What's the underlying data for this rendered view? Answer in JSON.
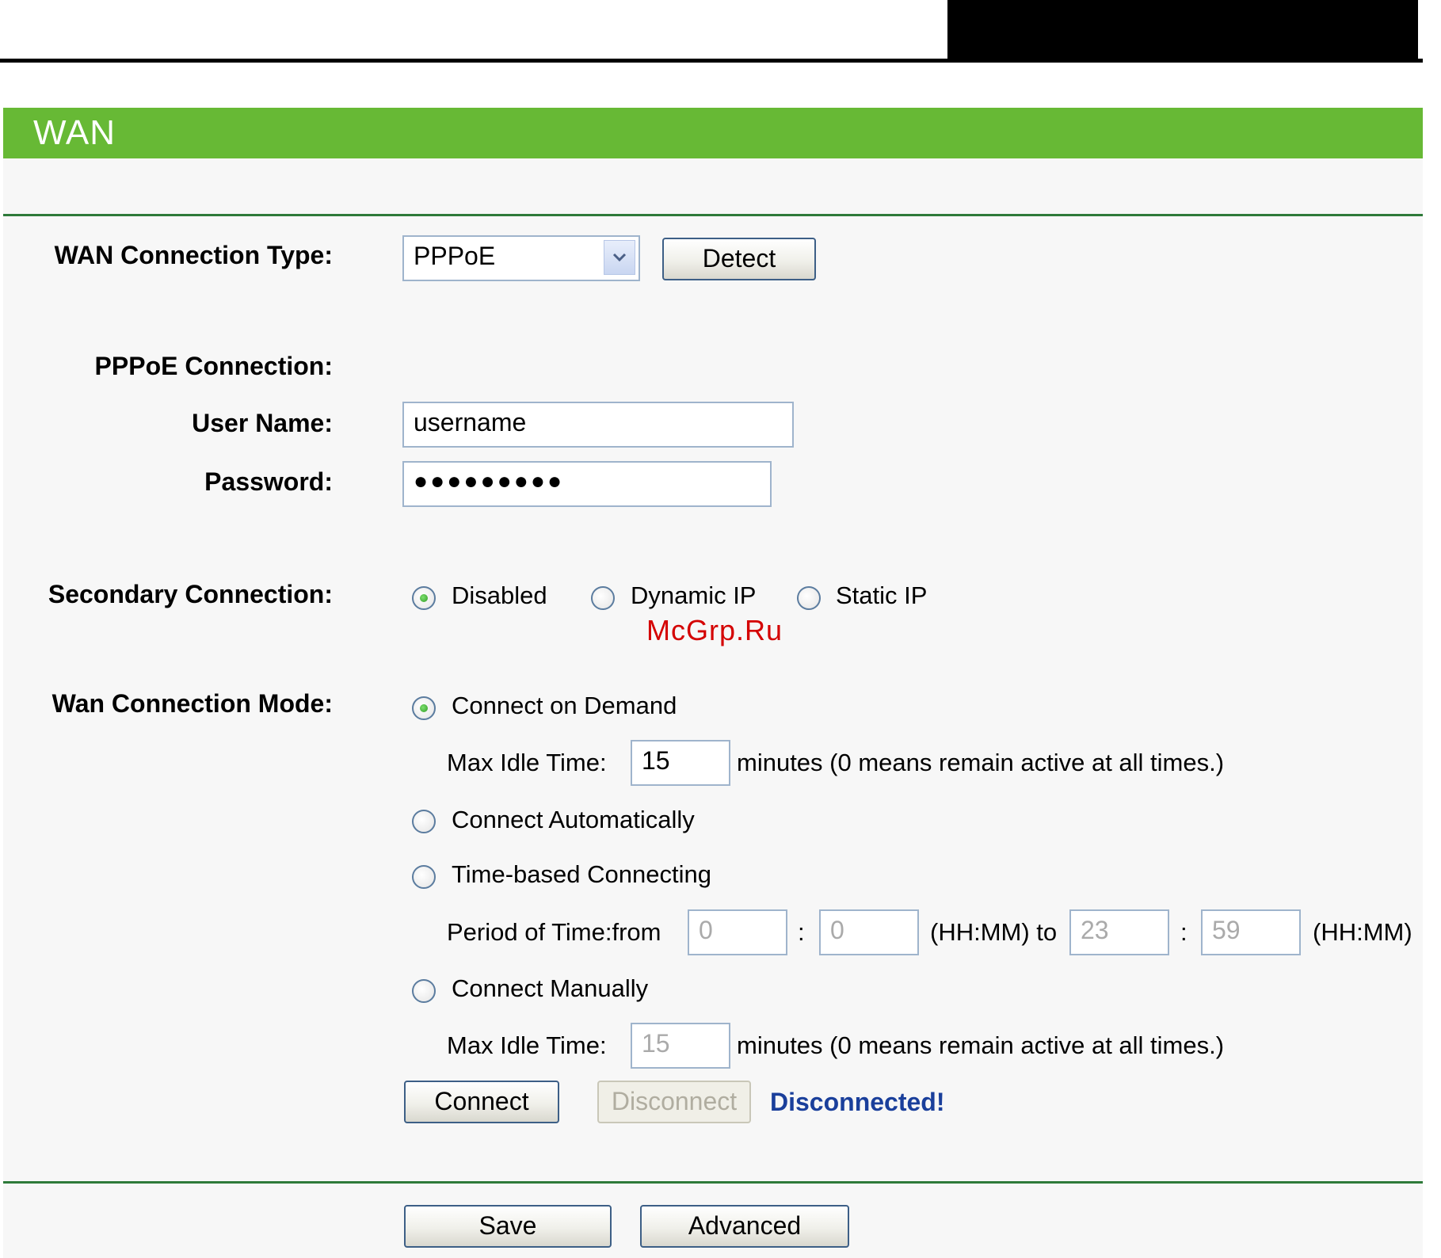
{
  "page": {
    "title": "WAN"
  },
  "wan_type": {
    "label": "WAN Connection Type:",
    "value": "PPPoE",
    "detect_label": "Detect"
  },
  "pppoe": {
    "section_label": "PPPoE Connection:",
    "username_label": "User Name:",
    "username_value": "username",
    "password_label": "Password:",
    "password_value": "●●●●●●●●●"
  },
  "secondary": {
    "label": "Secondary Connection:",
    "options": [
      "Disabled",
      "Dynamic IP",
      "Static IP"
    ],
    "selected": "Disabled"
  },
  "watermark": "McGrp.Ru",
  "mode": {
    "label": "Wan Connection Mode:",
    "on_demand": "Connect on Demand",
    "max_idle_label": "Max Idle Time:",
    "max_idle_value": "15",
    "idle_note": "minutes (0 means remain active at all times.)",
    "automatic": "Connect Automatically",
    "time_based": "Time-based Connecting",
    "period_label": "Period of Time:from",
    "from_hh": "0",
    "from_mm": "0",
    "colon": ":",
    "hhmm_to": "(HH:MM) to",
    "to_hh": "23",
    "to_mm": "59",
    "hhmm": "(HH:MM)",
    "manual": "Connect Manually",
    "manual_idle_label": "Max Idle Time:",
    "manual_idle_value": "15",
    "manual_idle_note": "minutes (0 means remain active at all times.)",
    "selected": "Connect on Demand"
  },
  "connection": {
    "connect_label": "Connect",
    "disconnect_label": "Disconnect",
    "status": "Disconnected!"
  },
  "footer": {
    "save_label": "Save",
    "advanced_label": "Advanced"
  },
  "colors": {
    "header": "#67b935",
    "status": "#1a3f9b",
    "watermark": "#d40000",
    "rule": "#2e7a3a"
  }
}
